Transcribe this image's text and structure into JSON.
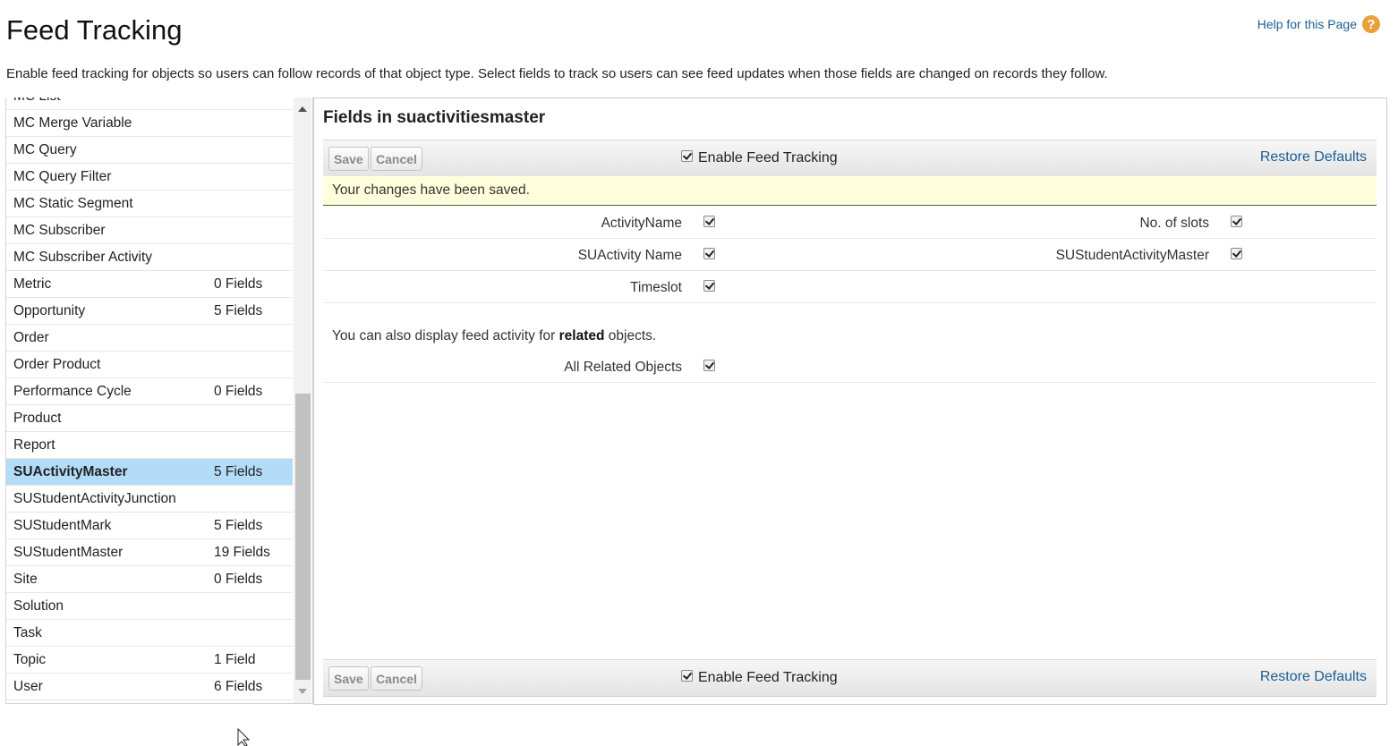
{
  "page": {
    "title": "Feed Tracking",
    "help_link": "Help for this Page",
    "intro": "Enable feed tracking for objects so users can follow records of that object type. Select fields to track so users can see feed updates when those fields are changed on records they follow."
  },
  "objects": [
    {
      "name": "MC List",
      "fields": ""
    },
    {
      "name": "MC Merge Variable",
      "fields": ""
    },
    {
      "name": "MC Query",
      "fields": ""
    },
    {
      "name": "MC Query Filter",
      "fields": ""
    },
    {
      "name": "MC Static Segment",
      "fields": ""
    },
    {
      "name": "MC Subscriber",
      "fields": ""
    },
    {
      "name": "MC Subscriber Activity",
      "fields": ""
    },
    {
      "name": "Metric",
      "fields": "0 Fields"
    },
    {
      "name": "Opportunity",
      "fields": "5 Fields"
    },
    {
      "name": "Order",
      "fields": ""
    },
    {
      "name": "Order Product",
      "fields": ""
    },
    {
      "name": "Performance Cycle",
      "fields": "0 Fields"
    },
    {
      "name": "Product",
      "fields": ""
    },
    {
      "name": "Report",
      "fields": ""
    },
    {
      "name": "SUActivityMaster",
      "fields": "5 Fields"
    },
    {
      "name": "SUStudentActivityJunction",
      "fields": ""
    },
    {
      "name": "SUStudentMark",
      "fields": "5 Fields"
    },
    {
      "name": "SUStudentMaster",
      "fields": "19 Fields"
    },
    {
      "name": "Site",
      "fields": "0 Fields"
    },
    {
      "name": "Solution",
      "fields": ""
    },
    {
      "name": "Task",
      "fields": ""
    },
    {
      "name": "Topic",
      "fields": "1 Field"
    },
    {
      "name": "User",
      "fields": "6 Fields"
    }
  ],
  "selected_object": "SUActivityMaster",
  "panel": {
    "title": "Fields in suactivitiesmaster",
    "save_label": "Save",
    "cancel_label": "Cancel",
    "enable_label": "Enable Feed Tracking",
    "restore_label": "Restore Defaults",
    "saved_message": "Your changes have been saved.",
    "fields": {
      "activity_name": "ActivityName",
      "no_of_slots": "No. of slots",
      "suactivity_name": "SUActivity Name",
      "sustudent_activity_master": "SUStudentActivityMaster",
      "timeslot": "Timeslot"
    },
    "related_prefix": "You can also display feed activity for ",
    "related_bold": "related",
    "related_suffix": " objects.",
    "all_related_label": "All Related Objects"
  },
  "icons": {
    "help": "question-mark-icon",
    "checkbox": "checked-checkbox-icon",
    "scroll_up": "triangle-up-icon",
    "scroll_down": "triangle-down-icon"
  },
  "colors": {
    "link": "#1a5e95",
    "selected_row": "#b3dcf8",
    "saved_banner": "#ffffdc",
    "help_icon": "#e8a13c"
  }
}
